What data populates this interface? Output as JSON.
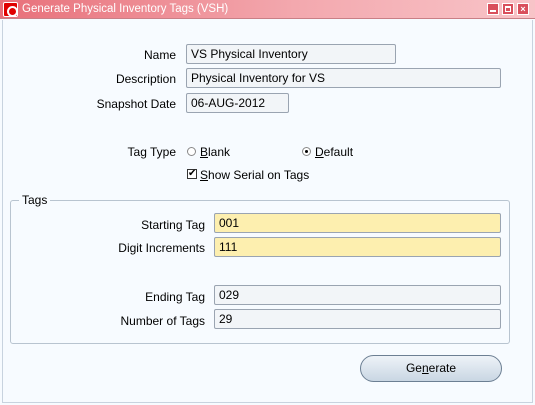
{
  "window": {
    "title": "Generate Physical Inventory Tags (VSH)"
  },
  "form": {
    "name_label": "Name",
    "name_value": "VS Physical Inventory",
    "description_label": "Description",
    "description_value": "Physical Inventory for VS",
    "snapshot_label": "Snapshot Date",
    "snapshot_value": "06-AUG-2012",
    "tag_type_label": "Tag Type",
    "tag_type_options": [
      "Blank",
      "Default"
    ],
    "tag_type_selected": "Default",
    "show_serial_label": "Show Serial on Tags",
    "show_serial_checked": true
  },
  "tags": {
    "group_title": "Tags",
    "starting_tag_label": "Starting Tag",
    "starting_tag_value": "001",
    "digit_increments_label": "Digit Increments",
    "digit_increments_value": "111",
    "ending_tag_label": "Ending Tag",
    "ending_tag_value": "029",
    "number_of_tags_label": "Number of Tags",
    "number_of_tags_value": "29"
  },
  "actions": {
    "generate_label": "Generate"
  },
  "colors": {
    "required_field": "#fdefaf",
    "titlebar": "#e8707a"
  }
}
